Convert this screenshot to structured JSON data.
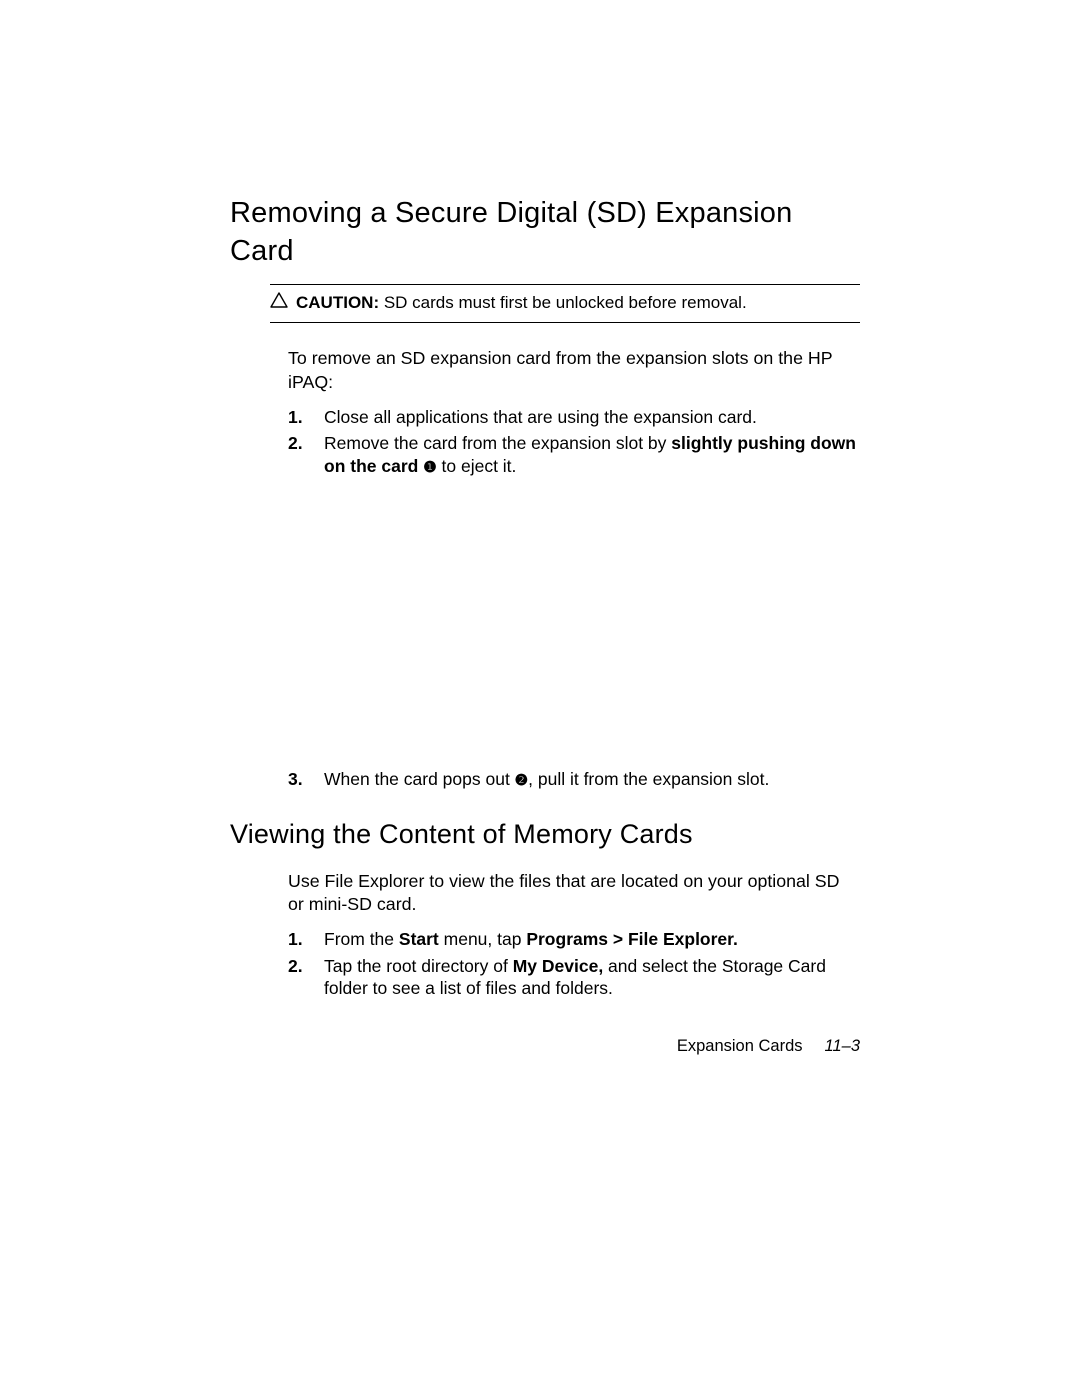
{
  "section1": {
    "heading": "Removing a Secure Digital (SD) Expansion Card",
    "caution_label": "CAUTION:",
    "caution_body": "SD cards must first be unlocked before removal.",
    "intro": "To remove an SD expansion card from the expansion slots on the HP iPAQ:",
    "step1_num": "1.",
    "step1": "Close all applications that are using the expansion card.",
    "step2_num": "2.",
    "step2_a": "Remove the card from the expansion slot by ",
    "step2_b": "slightly pushing down on the card ",
    "step2_ref": "❶",
    "step2_c": " to eject it.",
    "step3_num": "3.",
    "step3_a": "When the card pops out ",
    "step3_ref": "❷",
    "step3_b": ", pull it from the expansion slot."
  },
  "section2": {
    "heading": "Viewing the Content of Memory Cards",
    "intro": "Use File Explorer to view the files that are located on your optional SD or mini-SD card.",
    "step1_num": "1.",
    "step1_a": "From the ",
    "step1_b": "Start",
    "step1_c": " menu, tap ",
    "step1_d": "Programs > File Explorer.",
    "step2_num": "2.",
    "step2_a": "Tap the root directory of ",
    "step2_b": "My Device,",
    "step2_c": " and select the Storage Card folder to see a list of files and folders."
  },
  "footer": {
    "title": "Expansion Cards",
    "page": "11–3"
  }
}
